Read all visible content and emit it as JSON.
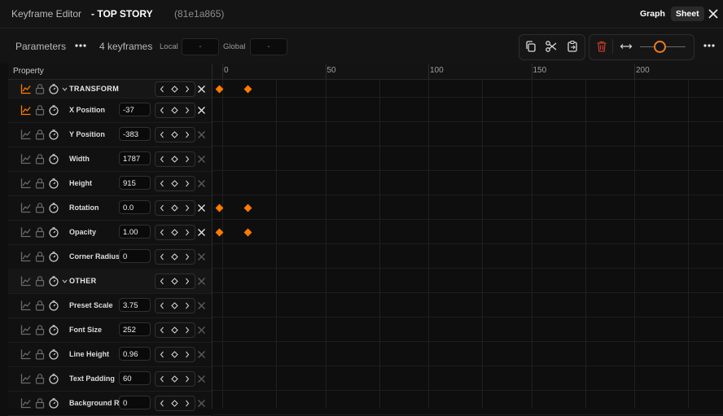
{
  "window": {
    "app_title": "Keyframe Editor",
    "document_name": "- TOP STORY",
    "document_id": "(81e1a865)",
    "tabs": [
      "Graph",
      "Sheet"
    ],
    "active_tab": "Sheet"
  },
  "toolbar": {
    "parameters_label": "Parameters",
    "keyframe_count": "4 keyframes",
    "local_label": "Local",
    "local_value": "-",
    "global_label": "Global",
    "global_value": "-"
  },
  "table": {
    "property_header": "Property",
    "ruler_ticks": [
      "0",
      "50",
      "100",
      "150",
      "200"
    ]
  },
  "rows": [
    {
      "type": "group",
      "label": "TRANSFORM",
      "graph_active": true,
      "has_x": true
    },
    {
      "type": "prop",
      "label": "X Position",
      "value": "-37",
      "graph_active": true,
      "has_x": true
    },
    {
      "type": "prop",
      "label": "Y Position",
      "value": "-383",
      "graph_active": false,
      "has_x": false
    },
    {
      "type": "prop",
      "label": "Width",
      "value": "1787",
      "graph_active": false,
      "has_x": false
    },
    {
      "type": "prop",
      "label": "Height",
      "value": "915",
      "graph_active": false,
      "has_x": false
    },
    {
      "type": "prop",
      "label": "Rotation",
      "value": "0.0",
      "graph_active": false,
      "has_x": true
    },
    {
      "type": "prop",
      "label": "Opacity",
      "value": "1.00",
      "graph_active": false,
      "has_x": true
    },
    {
      "type": "prop",
      "label": "Corner Radius",
      "value": "0",
      "graph_active": false,
      "has_x": false
    },
    {
      "type": "group",
      "label": "OTHER",
      "graph_active": false,
      "has_x": false
    },
    {
      "type": "prop",
      "label": "Preset Scale",
      "value": "3.75",
      "graph_active": false,
      "has_x": false
    },
    {
      "type": "prop",
      "label": "Font Size",
      "value": "252",
      "graph_active": false,
      "has_x": false
    },
    {
      "type": "prop",
      "label": "Line Height",
      "value": "0.96",
      "graph_active": false,
      "has_x": false
    },
    {
      "type": "prop",
      "label": "Text Padding",
      "value": "60",
      "graph_active": false,
      "has_x": false
    },
    {
      "type": "prop",
      "label": "Background Ra",
      "value": "0",
      "graph_active": false,
      "has_x": false
    }
  ],
  "keyframes": [
    {
      "row": 0,
      "frame": 0
    },
    {
      "row": 0,
      "frame": 14
    },
    {
      "row": 5,
      "frame": 0
    },
    {
      "row": 5,
      "frame": 14
    },
    {
      "row": 6,
      "frame": 0
    },
    {
      "row": 6,
      "frame": 14
    }
  ],
  "colors": {
    "accent": "#ff7a00",
    "delete": "#c0392b"
  }
}
